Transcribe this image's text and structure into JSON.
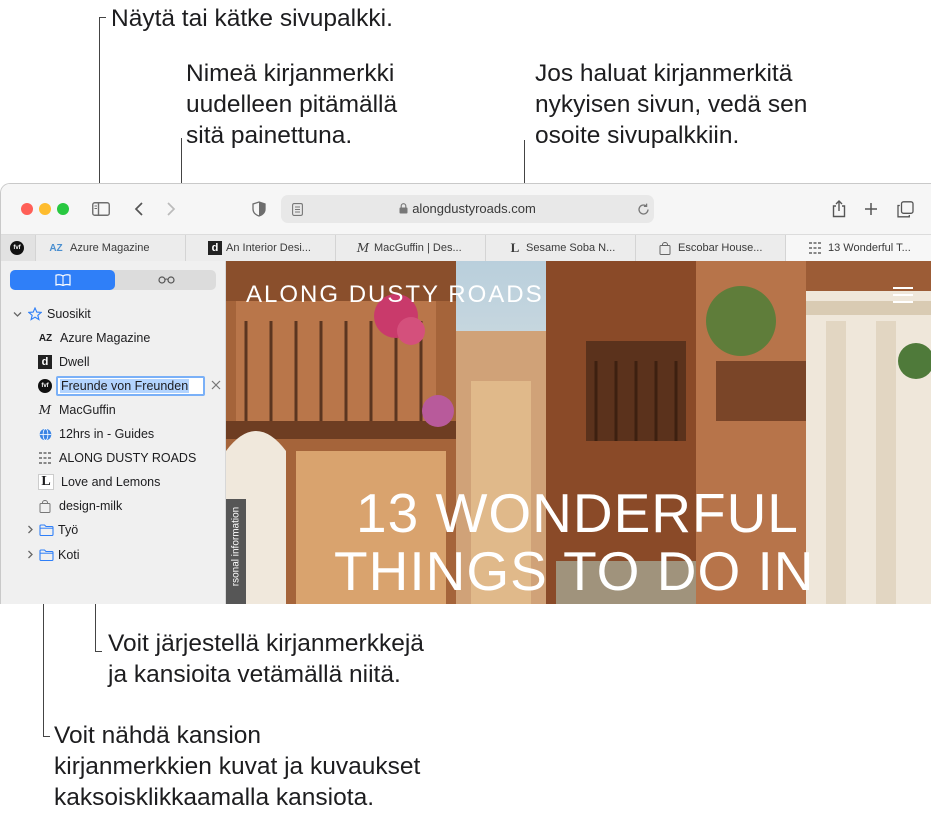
{
  "callouts": {
    "sidebar": "Näytä tai kätke sivupalkki.",
    "rename": "Nimeä kirjanmerkki\nuudelleen pitämällä\nsitä painettuna.",
    "drag_address": "Jos haluat kirjanmerkitä\nnykyisen sivun, vedä sen\nosoite sivupalkkiin.",
    "organize": "Voit järjestellä kirjanmerkkejä\nja kansioita vetämällä niitä.",
    "folder": "Voit nähdä kansion\nkirjanmerkkien kuvat ja kuvaukset\nkaksoisklikkaamalla kansiota."
  },
  "toolbar": {
    "address": "alongdustyroads.com",
    "icons": [
      "sidebar-icon",
      "back-icon",
      "forward-icon",
      "shield-icon",
      "reader-icon",
      "lock-icon",
      "reload-icon",
      "share-icon",
      "new-tab-icon",
      "tab-overview-icon"
    ]
  },
  "tabs": [
    {
      "favicon": "fvf",
      "label": ""
    },
    {
      "favicon": "AZ",
      "label": "Azure Magazine"
    },
    {
      "favicon": "d",
      "label": "An Interior Desi..."
    },
    {
      "favicon": "M",
      "label": "MacGuffin | Des..."
    },
    {
      "favicon": "L",
      "label": "Sesame Soba N..."
    },
    {
      "favicon": "bag",
      "label": "Escobar House..."
    },
    {
      "favicon": "grid",
      "label": "13 Wonderful T..."
    }
  ],
  "sidebar": {
    "section": "Suosikit",
    "editing_value": "Freunde von Freunden",
    "items": [
      {
        "favicon": "AZ",
        "label": "Azure Magazine"
      },
      {
        "favicon": "d",
        "label": "Dwell"
      },
      {
        "favicon": "fvf",
        "label": "Freunde von Freunden"
      },
      {
        "favicon": "M",
        "label": "MacGuffin"
      },
      {
        "favicon": "globe",
        "label": "12hrs in - Guides"
      },
      {
        "favicon": "grid",
        "label": "ALONG DUSTY ROADS"
      },
      {
        "favicon": "L",
        "label": "Love and Lemons"
      },
      {
        "favicon": "bag",
        "label": "design-milk"
      }
    ],
    "folders": [
      "Työ",
      "Koti"
    ]
  },
  "page": {
    "site_title": "ALONG DUSTY ROADS",
    "headline_1": "13 WONDERFUL",
    "headline_2": "THINGS TO DO IN",
    "side_tab": "rsonal information"
  },
  "colors": {
    "accent": "#2f7ff8",
    "close": "#ff5f57",
    "minimize": "#febc2e",
    "zoom": "#28c840"
  }
}
